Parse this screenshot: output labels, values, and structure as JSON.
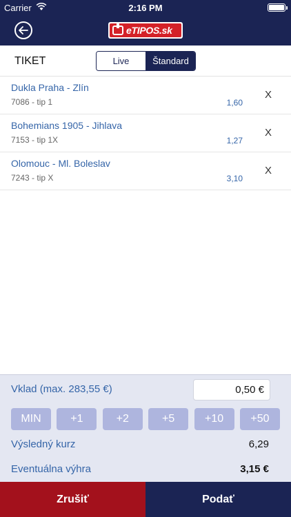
{
  "status_bar": {
    "carrier": "Carrier",
    "time": "2:16 PM"
  },
  "nav": {
    "logo_text": "eTIPOS.sk"
  },
  "tiket": {
    "title": "TIKET",
    "tabs": [
      {
        "label": "Live",
        "active": false
      },
      {
        "label": "Štandard",
        "active": true
      }
    ]
  },
  "bets": [
    {
      "match": "Dukla Praha - Zlín",
      "tip": "7086 - tip 1",
      "odd": "1,60",
      "remove": "X"
    },
    {
      "match": "Bohemians 1905 - Jihlava",
      "tip": "7153 - tip 1X",
      "odd": "1,27",
      "remove": "X"
    },
    {
      "match": "Olomouc - Ml. Boleslav",
      "tip": "7243 - tip X",
      "odd": "3,10",
      "remove": "X"
    }
  ],
  "stake": {
    "label": "Vklad (max. 283,55 €)",
    "value": "0,50 €",
    "quick_buttons": [
      "MIN",
      "+1",
      "+2",
      "+5",
      "+10",
      "+50"
    ]
  },
  "summary": {
    "kurz_label": "Výsledný kurz",
    "kurz_value": "6,29",
    "vyhra_label": "Eventuálna výhra",
    "vyhra_value": "3,15 €"
  },
  "actions": {
    "cancel": "Zrušiť",
    "submit": "Podať"
  },
  "colors": {
    "navy": "#1b2454",
    "red": "#a3111c",
    "link_blue": "#3565a8",
    "quick_btn": "#aeb5de",
    "panel_bg": "#e4e7f2"
  }
}
